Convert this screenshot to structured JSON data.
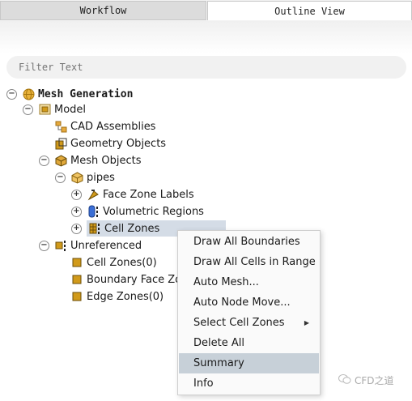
{
  "tabs": {
    "workflow": "Workflow",
    "outline": "Outline View"
  },
  "filter": {
    "placeholder": "Filter Text"
  },
  "tree": {
    "root": "Mesh Generation",
    "model": "Model",
    "cad": "CAD Assemblies",
    "geom": "Geometry Objects",
    "mesh_objects": "Mesh Objects",
    "pipes": "pipes",
    "face_zone_labels": "Face Zone Labels",
    "volumetric_regions": "Volumetric Regions",
    "cell_zones": "Cell Zones",
    "unreferenced": "Unreferenced",
    "cell_zones_0": "Cell Zones(0)",
    "boundary_face_zones": "Boundary Face Zo",
    "edge_zones_0": "Edge Zones(0)"
  },
  "context_menu": {
    "items": [
      "Draw All Boundaries",
      "Draw All Cells in Range",
      "Auto Mesh...",
      "Auto Node Move...",
      "Select Cell Zones",
      "Delete All",
      "Summary",
      "Info"
    ],
    "highlighted": "Summary"
  },
  "watermark": "CFD之道",
  "colors": {
    "selection": "#d4dce6",
    "menu_highlight": "#c7d0d8",
    "icon_gold": "#d19a1a"
  }
}
